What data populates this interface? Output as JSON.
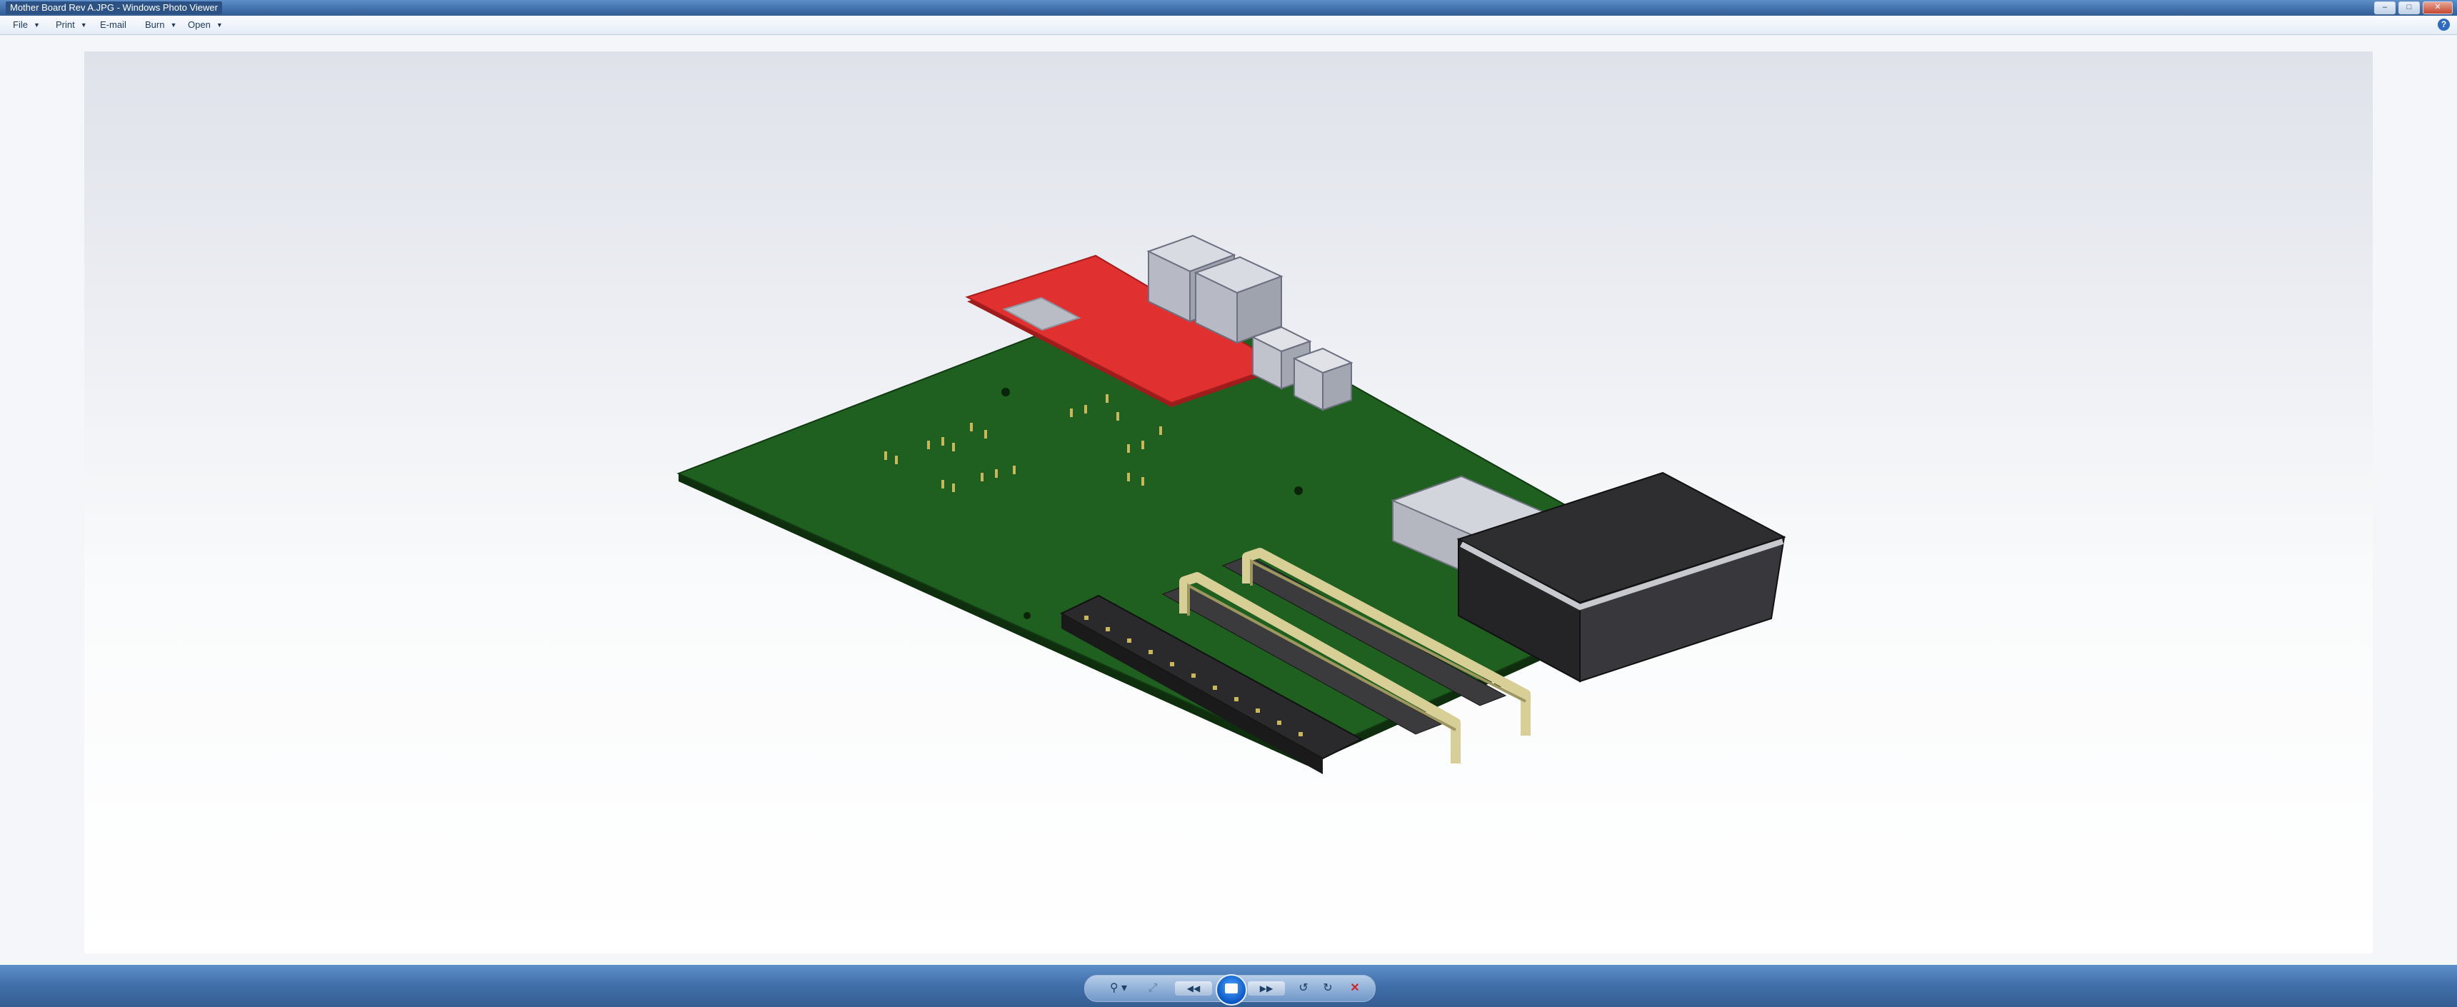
{
  "window": {
    "title": "Mother Board Rev A.JPG - Windows Photo Viewer",
    "minimize_label": "–",
    "maximize_label": "□",
    "close_label": "✕"
  },
  "menu": {
    "items": [
      {
        "label": "File"
      },
      {
        "label": "Print"
      },
      {
        "label": "E-mail"
      },
      {
        "label": "Burn"
      },
      {
        "label": "Open"
      }
    ],
    "dropdown_glyph": "▼",
    "help_label": "?"
  },
  "toolbar": {
    "zoom_glyph": "⚲ ▾",
    "actual_size_glyph": "⤢",
    "previous_glyph": "◀◀",
    "next_glyph": "▶▶",
    "rotate_left_glyph": "↺",
    "rotate_right_glyph": "↻",
    "delete_glyph": "✕"
  },
  "colors": {
    "pcb_green": "#1f5f1f",
    "red_board": "#e03030",
    "accent_blue": "#3f6ea8"
  },
  "icons": [
    "help-icon",
    "zoom-icon",
    "actual-size-icon",
    "previous-icon",
    "slideshow-icon",
    "next-icon",
    "rotate-left-icon",
    "rotate-right-icon",
    "delete-icon"
  ]
}
